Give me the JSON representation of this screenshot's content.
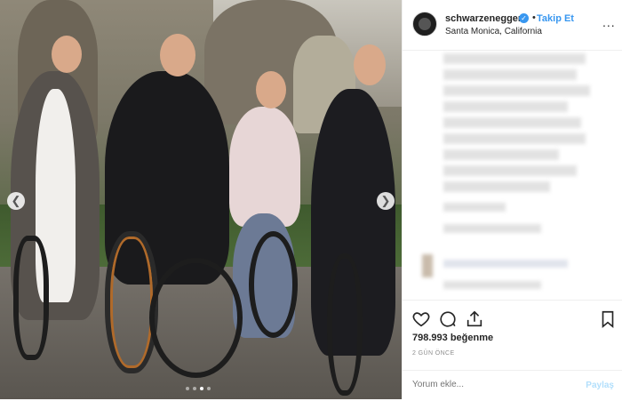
{
  "post": {
    "photo": {
      "alt_description": ""
    },
    "carousel": {
      "count": 4,
      "active_index": 2
    },
    "header": {
      "username": "schwarzenegger",
      "verified": true,
      "separator": "•",
      "follow_label": "Takip Et",
      "location": "Santa Monica, California",
      "more_label": "..."
    },
    "engagement": {
      "likes_count": "798.993",
      "likes_word": "beğenme",
      "timestamp": "2 GÜN ÖNCE"
    },
    "comment": {
      "placeholder": "Yorum ekle...",
      "post_label": "Paylaş"
    },
    "icons": [
      "heart-icon",
      "comment-icon",
      "share-icon",
      "bookmark-icon",
      "chevron-left-icon",
      "chevron-right-icon"
    ],
    "colors": {
      "accent": "#3897f0",
      "text": "#262626",
      "muted": "#8e8e8e",
      "post_disabled": "#b2dffc"
    }
  }
}
